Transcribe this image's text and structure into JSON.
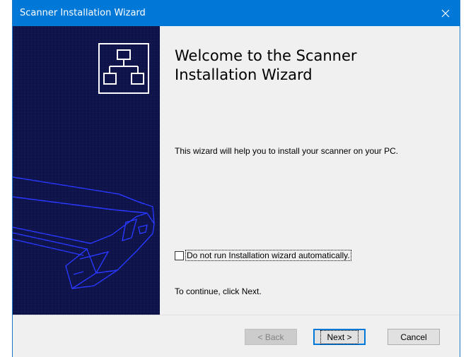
{
  "window": {
    "title": "Scanner Installation Wizard",
    "close_glyph": "✕"
  },
  "content": {
    "heading_line1": "Welcome to the Scanner",
    "heading_line2": "Installation Wizard",
    "description": "This wizard will help you to install your scanner on your PC.",
    "checkbox_label": "Do not run Installation wizard automatically.",
    "checkbox_checked": false,
    "continue_text": "To continue, click Next."
  },
  "footer": {
    "back_label": "< Back",
    "next_label": "Next >",
    "cancel_label": "Cancel"
  },
  "colors": {
    "titlebar": "#0078d7",
    "side_panel": "#00063a",
    "art_lines": "#2838ff"
  },
  "icons": {
    "close": "close-icon",
    "network": "network-icon"
  }
}
